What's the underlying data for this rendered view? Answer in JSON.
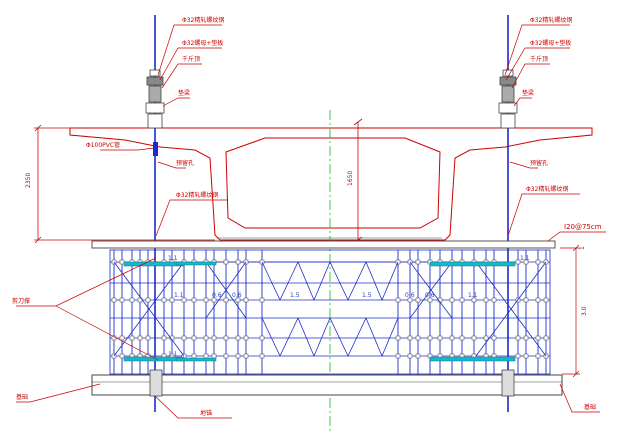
{
  "callouts": {
    "left_bar": "Φ32精轧螺纹钢",
    "left_anchor": "Φ32螺母+垫板",
    "left_jack": "千斤顶",
    "left_beam": "垫梁",
    "left_duct": "Φ100PVC管",
    "left_hole": "预留孔",
    "left_rod": "Φ32精轧螺纹钢",
    "right_bar": "Φ32精轧螺纹钢",
    "right_anchor": "Φ32螺母+垫板",
    "right_jack": "千斤顶",
    "right_beam": "垫梁",
    "right_hole": "预留孔",
    "right_rod": "Φ32精轧螺纹钢",
    "beam_spec": "I20@75cm",
    "left_brace": "剪刀撑",
    "left_found": "基础",
    "left_pile": "地锚",
    "right_found": "基础"
  },
  "dims": {
    "deck_height": "2350",
    "box_height": "1650",
    "web_top": "1"
  },
  "pier_labels": {
    "top_left": "1.1",
    "top_right": "1.1",
    "bot_left": "1.1",
    "mid_l1": "1.1",
    "mid_l2": "0.6",
    "mid_l3": "0.6",
    "mid_c1": "1.5",
    "mid_c2": "1.5",
    "mid_r1": "0.6",
    "mid_r2": "0.6",
    "mid_r3": "1.1",
    "right_h": "3.0",
    "right_top": "1.1"
  },
  "colors": {
    "concrete": "#cc0000",
    "steel": "#1a2ccc",
    "centerline": "#33bb33",
    "cyan": "#19b5c8",
    "gray": "#444444"
  }
}
